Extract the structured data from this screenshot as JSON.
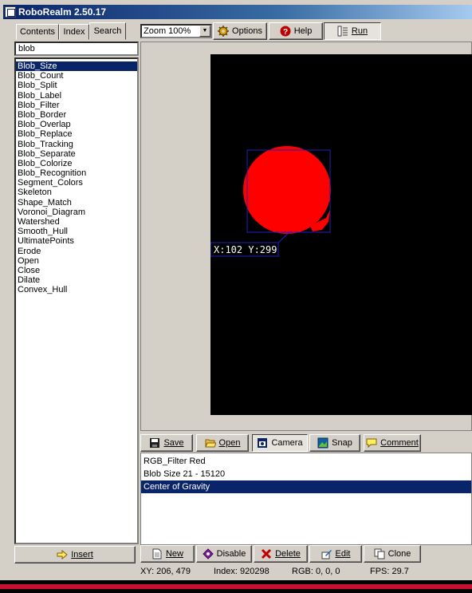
{
  "window": {
    "title": "RoboRealm 2.50.17"
  },
  "left_panel": {
    "tabs": [
      "Contents",
      "Index",
      "Search"
    ],
    "active_tab": "Search",
    "search_value": "blob",
    "results": [
      "Blob_Size",
      "Blob_Count",
      "Blob_Split",
      "Blob_Label",
      "Blob_Filter",
      "Blob_Border",
      "Blob_Overlap",
      "Blob_Replace",
      "Blob_Tracking",
      "Blob_Separate",
      "Blob_Colorize",
      "Blob_Recognition",
      "Segment_Colors",
      "Skeleton",
      "Shape_Match",
      "Voronoi_Diagram",
      "Watershed",
      "Smooth_Hull",
      "UltimatePoints",
      "Erode",
      "Open",
      "Close",
      "Dilate",
      "Convex_Hull"
    ],
    "selected_result": "Blob_Size",
    "insert_label": "Insert"
  },
  "toolbar": {
    "zoom_value": "Zoom 100%",
    "options_label": "Options",
    "help_label": "Help",
    "run_label": "Run"
  },
  "image": {
    "background": "#000000",
    "blob_color": "#ff0000",
    "box_color": "#2020c0",
    "annotation": "X:102 Y:299"
  },
  "pipeline_toolbar": {
    "save_label": "Save",
    "open_label": "Open",
    "camera_label": "Camera",
    "snap_label": "Snap",
    "comment_label": "Comment"
  },
  "pipeline": {
    "items": [
      "RGB_Filter Red",
      "Blob Size 21 - 15120",
      "Center of Gravity"
    ],
    "selected_index": 2
  },
  "actions": {
    "new_label": "New",
    "disable_label": "Disable",
    "delete_label": "Delete",
    "edit_label": "Edit",
    "clone_label": "Clone"
  },
  "status": {
    "xy": "XY: 206, 479",
    "index": "Index: 920298",
    "rgb": "RGB: 0, 0, 0",
    "fps": "FPS: 29.7"
  }
}
